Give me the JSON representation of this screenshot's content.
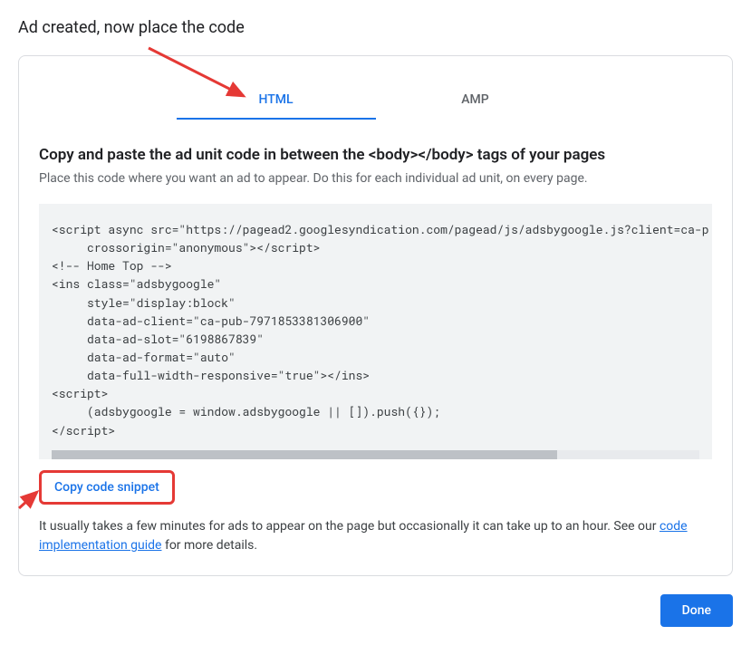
{
  "page": {
    "title": "Ad created, now place the code"
  },
  "tabs": {
    "html": "HTML",
    "amp": "AMP"
  },
  "main": {
    "heading": "Copy and paste the ad unit code in between the <body></body> tags of your pages",
    "subtext": "Place this code where you want an ad to appear. Do this for each individual ad unit, on every page.",
    "code": "<script async src=\"https://pagead2.googlesyndication.com/pagead/js/adsbygoogle.js?client=ca-p\n     crossorigin=\"anonymous\"></script>\n<!-- Home Top -->\n<ins class=\"adsbygoogle\"\n     style=\"display:block\"\n     data-ad-client=\"ca-pub-7971853381306900\"\n     data-ad-slot=\"6198867839\"\n     data-ad-format=\"auto\"\n     data-full-width-responsive=\"true\"></ins>\n<script>\n     (adsbygoogle = window.adsbygoogle || []).push({});\n</script>",
    "copy_label": "Copy code snippet",
    "helper_pre": "It usually takes a few minutes for ads to appear on the page but occasionally it can take up to an hour. See our ",
    "helper_link": "code implementation guide",
    "helper_post": " for more details."
  },
  "footer": {
    "done_label": "Done"
  }
}
